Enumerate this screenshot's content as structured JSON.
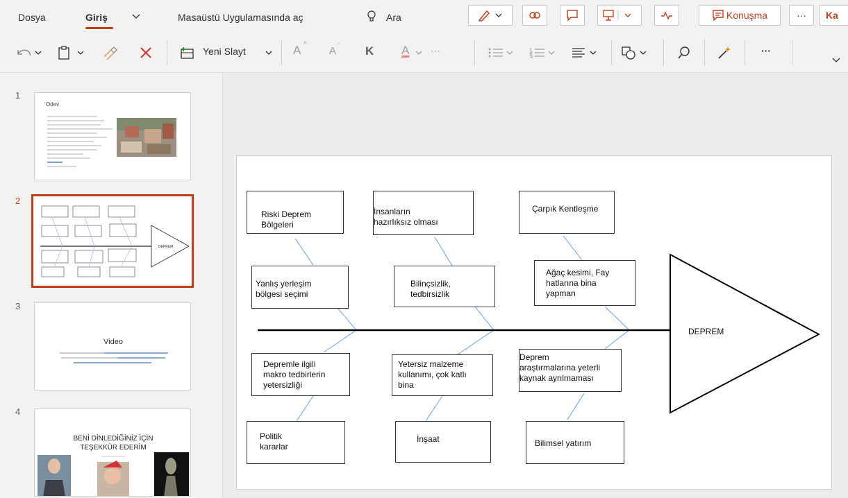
{
  "menu": {
    "file": "Dosya",
    "home": "Giriş",
    "open_desktop": "Masaüstü Uygulamasında aç",
    "search": "Ara",
    "konusma": "Konuşma",
    "more": "···",
    "cut_off": "Ka"
  },
  "ribbon": {
    "new_slide": "Yeni Slayt",
    "font_grow": "A",
    "font_shrink": "A",
    "bold": "K",
    "font_color_letter": "A",
    "more": "···"
  },
  "thumbnails": [
    {
      "number": "1",
      "title": "Odev"
    },
    {
      "number": "2",
      "center_label": "DEPREM"
    },
    {
      "number": "3",
      "title": "Video"
    },
    {
      "number": "4",
      "title_line1": "BENİ DİNLEDİĞİNİZ İÇİN",
      "title_line2": "TEŞEKKÜR EDERİM"
    }
  ],
  "slide": {
    "head_label": "DEPREM",
    "boxes": {
      "b1": "Riski Deprem\nBölgeleri",
      "b2": "İnsanların\nhazırlıksız olması",
      "b3": "Çarpık Kentleşme",
      "b4": "Yanlış yerleşim\nbölgesi seçimi",
      "b5": "Bilinçsizlik,\ntedbirsizlik",
      "b6": "Ağaç kesimi, Fay\nhatlarına bina\nyapman",
      "b7": "Depremle ilgili\nmakro tedbirlerin\nyetersizliği",
      "b8": "Yetersiz malzeme\nkullanımı, çok katlı\nbina",
      "b9": "Deprem\naraştırmalarına yeterli\nkaynak ayrılmaması",
      "b10": "Politik\nkararlar",
      "b11": "İnşaat",
      "b12": "Bilimsel yatırım"
    }
  },
  "colors": {
    "accent": "#c43e1c",
    "diagram_line": "#8db4e2",
    "pane_bg": "#f3f2f1"
  }
}
